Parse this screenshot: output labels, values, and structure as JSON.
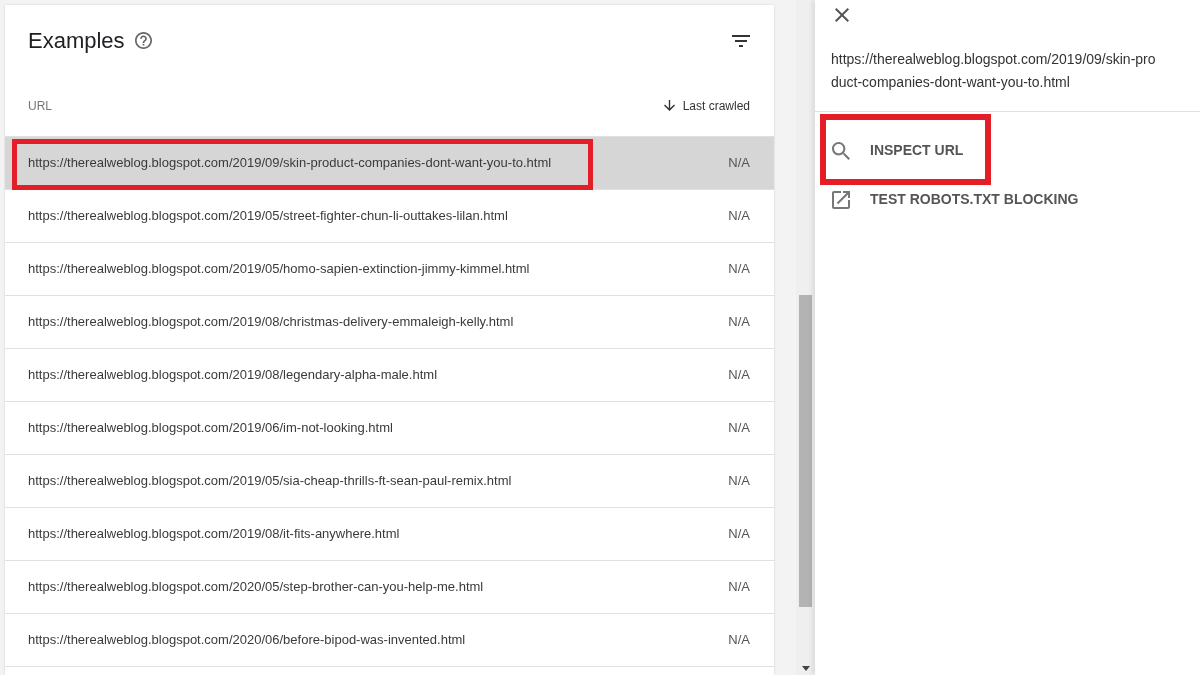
{
  "card": {
    "title": "Examples",
    "columns": [
      {
        "label": "URL",
        "sorted": false
      },
      {
        "label": "Last crawled",
        "sorted": true
      }
    ],
    "rows": [
      {
        "url": "https://therealweblog.blogspot.com/2019/09/skin-product-companies-dont-want-you-to.html",
        "last_crawled": "N/A",
        "selected": true,
        "highlighted": true
      },
      {
        "url": "https://therealweblog.blogspot.com/2019/05/street-fighter-chun-li-outtakes-lilan.html",
        "last_crawled": "N/A",
        "selected": false,
        "highlighted": false
      },
      {
        "url": "https://therealweblog.blogspot.com/2019/05/homo-sapien-extinction-jimmy-kimmel.html",
        "last_crawled": "N/A",
        "selected": false,
        "highlighted": false
      },
      {
        "url": "https://therealweblog.blogspot.com/2019/08/christmas-delivery-emmaleigh-kelly.html",
        "last_crawled": "N/A",
        "selected": false,
        "highlighted": false
      },
      {
        "url": "https://therealweblog.blogspot.com/2019/08/legendary-alpha-male.html",
        "last_crawled": "N/A",
        "selected": false,
        "highlighted": false
      },
      {
        "url": "https://therealweblog.blogspot.com/2019/06/im-not-looking.html",
        "last_crawled": "N/A",
        "selected": false,
        "highlighted": false
      },
      {
        "url": "https://therealweblog.blogspot.com/2019/05/sia-cheap-thrills-ft-sean-paul-remix.html",
        "last_crawled": "N/A",
        "selected": false,
        "highlighted": false
      },
      {
        "url": "https://therealweblog.blogspot.com/2019/08/it-fits-anywhere.html",
        "last_crawled": "N/A",
        "selected": false,
        "highlighted": false
      },
      {
        "url": "https://therealweblog.blogspot.com/2020/05/step-brother-can-you-help-me.html",
        "last_crawled": "N/A",
        "selected": false,
        "highlighted": false
      },
      {
        "url": "https://therealweblog.blogspot.com/2020/06/before-bipod-was-invented.html",
        "last_crawled": "N/A",
        "selected": false,
        "highlighted": false
      }
    ]
  },
  "panel": {
    "url_lines": [
      "https://therealweblog.blogspot.com/2019/09/skin-pro",
      "duct-companies-dont-want-you-to.html"
    ],
    "actions": [
      {
        "kind": "search",
        "label": "INSPECT URL",
        "highlighted": true
      },
      {
        "kind": "link",
        "label": "TEST ROBOTS.TXT BLOCKING",
        "highlighted": false
      }
    ]
  }
}
